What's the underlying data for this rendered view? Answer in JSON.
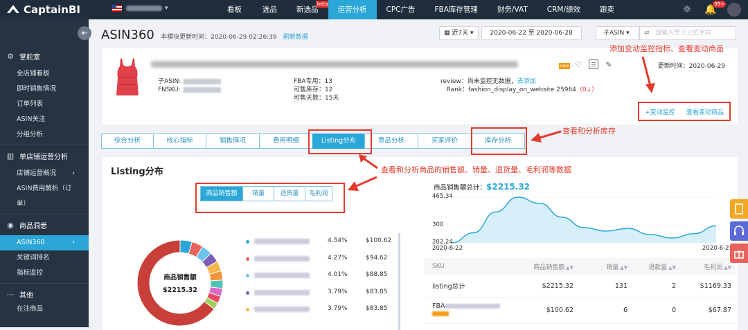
{
  "app": {
    "name": "CaptainBI"
  },
  "topnav": {
    "items": [
      "看板",
      "选品",
      "新选品",
      "运营分析",
      "CPC广告",
      "FBA库存管理",
      "财务/VAT",
      "CRM/绩效",
      "跟卖"
    ],
    "beta": "beta",
    "notify_count": "99+"
  },
  "sidebar": {
    "sections": [
      {
        "label": "掌舵室",
        "icon": "gear-icon",
        "items": [
          "全店铺看板",
          "即时销售情况",
          "订单列表",
          "ASIN关注",
          "分组分析"
        ]
      },
      {
        "label": "单店铺运营分析",
        "icon": "bar-chart-icon",
        "items": [
          "店铺运营概况",
          "ASIN费用解析（订",
          "单）"
        ]
      },
      {
        "label": "商品洞悉",
        "icon": "eye-icon",
        "items": [
          "ASIN360",
          "关键词排名",
          "指标监控"
        ]
      },
      {
        "label": "其他",
        "icon": "dots-icon",
        "items": [
          "在注商品"
        ]
      }
    ],
    "active_item": "ASIN360"
  },
  "header": {
    "title": "ASIN360",
    "update_label": "本模块更新时间：2020-06-29 02:26:39",
    "refresh": "刷新数据",
    "period": "近7天",
    "date_range": "2020-06-22 至 2020-06-28",
    "asin_select": "子ASIN",
    "search_placeholder": "请输入至少三位字符"
  },
  "product": {
    "child_asin_label": "子ASIN:",
    "fnsku_label": "FNSKU:",
    "fba_line": "FBA专用：13",
    "stock_line": "可售库存：12",
    "days_line": "可售天数：15天",
    "review_label": "review：尚未监控无数据，",
    "review_link": "去添加",
    "rank_label": "Rank：fashion_display_on_website 25964",
    "rank_change": "（0↓）",
    "new_tag": "new",
    "update_time": "更新时间：2020-06-29",
    "monitor_link": "+变动监控",
    "view_changes": "查看变动商品"
  },
  "tabs": [
    "综合分析",
    "核心指标",
    "销售情况",
    "费用明细",
    "Listing分布",
    "竞品分析",
    "买家评价",
    "库存分析"
  ],
  "active_tab": "Listing分布",
  "annotations": {
    "monitor": "添加变动监控指标、查看变动商品",
    "inventory": "查看和分析库存",
    "listing": "查看和分析商品的销售额、销量、退货量、毛利润等数据"
  },
  "listing": {
    "title": "Listing分布",
    "metric_tabs": [
      "商品销售额",
      "销量",
      "退货量",
      "毛利润"
    ],
    "donut_label": "商品销售额",
    "donut_value": "$2215.32",
    "legend": [
      {
        "pct": "4.54%",
        "amount": "$100.62",
        "color": "#2aa6d8"
      },
      {
        "pct": "4.27%",
        "amount": "$94.62",
        "color": "#e8615a"
      },
      {
        "pct": "4.01%",
        "amount": "$88.85",
        "color": "#6cc4ee"
      },
      {
        "pct": "3.79%",
        "amount": "$83.85",
        "color": "#7b5fb8"
      },
      {
        "pct": "3.79%",
        "amount": "$83.85",
        "color": "#f5b84a"
      }
    ],
    "trend_title": "商品销售额总计：",
    "trend_total": "$2215.32",
    "trend_y_ticks": [
      "465.34",
      "300",
      "202.24"
    ],
    "trend_x_ticks": [
      "2020-6-22",
      "2020-6-2"
    ],
    "trend_values": [
      202.24,
      260,
      380,
      465.34,
      430,
      350,
      290,
      270,
      285,
      250,
      230,
      255,
      300
    ],
    "table_headers": [
      "SKU",
      "商品销售额",
      "销量",
      "退款量",
      "毛利润"
    ],
    "rows": [
      {
        "sku": "listing总计",
        "sales": "$2215.32",
        "qty": "131",
        "refund": "2",
        "profit": "$1169.33"
      },
      {
        "sku": "FBA",
        "sales": "$100.62",
        "qty": "6",
        "refund": "0",
        "profit": "$67.87"
      }
    ]
  },
  "colors": {
    "accent": "#2aa6d8",
    "highlight": "#e23b2e",
    "topbar": "#1f2d3d",
    "sidebar": "#263342"
  }
}
